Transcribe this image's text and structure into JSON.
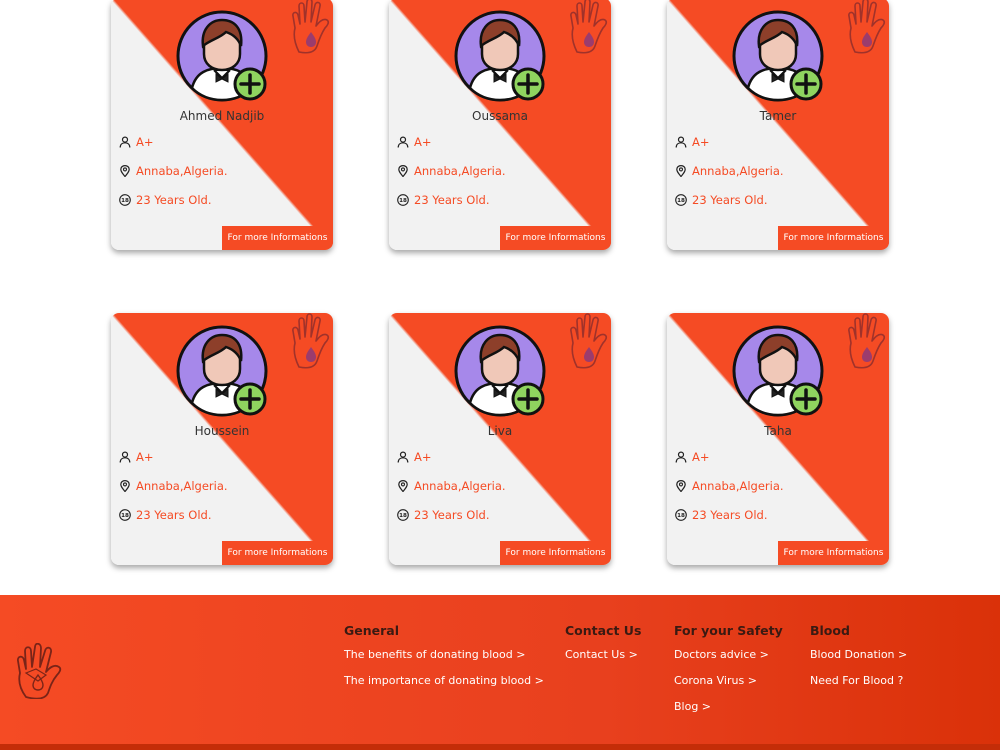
{
  "cards": [
    {
      "name": "Ahmed Nadjib",
      "blood": "A+",
      "location": "Annaba,Algeria.",
      "age": "23 Years Old.",
      "button": "For more Informations"
    },
    {
      "name": "Oussama",
      "blood": "A+",
      "location": "Annaba,Algeria.",
      "age": "23 Years Old.",
      "button": "For more Informations"
    },
    {
      "name": "Tamer",
      "blood": "A+",
      "location": "Annaba,Algeria.",
      "age": "23 Years Old.",
      "button": "For more Informations"
    },
    {
      "name": "Houssein",
      "blood": "A+",
      "location": "Annaba,Algeria.",
      "age": "23 Years Old.",
      "button": "For more Informations"
    },
    {
      "name": "Liva",
      "blood": "A+",
      "location": "Annaba,Algeria.",
      "age": "23 Years Old.",
      "button": "For more Informations"
    },
    {
      "name": "Taha",
      "blood": "A+",
      "location": "Annaba,Algeria.",
      "age": "23 Years Old.",
      "button": "For more Informations"
    }
  ],
  "icons": {
    "blood": "person-icon",
    "location": "location-pin-icon",
    "age": "age-18-icon",
    "corner": "hand-blood-drop-icon",
    "avatar": "donor-avatar-add-icon"
  },
  "footer": {
    "general": {
      "title": "General",
      "links": [
        "The benefits of donating blood >",
        "The importance of donating blood >"
      ]
    },
    "contact": {
      "title": "Contact Us",
      "links": [
        "Contact Us >"
      ]
    },
    "safety": {
      "title": "For your Safety",
      "links": [
        "Doctors advice >",
        "Corona Virus >",
        "Blog >"
      ]
    },
    "blood": {
      "title": "Blood",
      "links": [
        "Blood Donation >",
        "Need For Blood ?"
      ]
    }
  },
  "colors": {
    "accent": "#f54b24",
    "card_bg": "#f2f2f2",
    "avatar_circle": "#a688ea",
    "plus_badge": "#8fd45f",
    "footer_heading": "#3a1a12"
  }
}
